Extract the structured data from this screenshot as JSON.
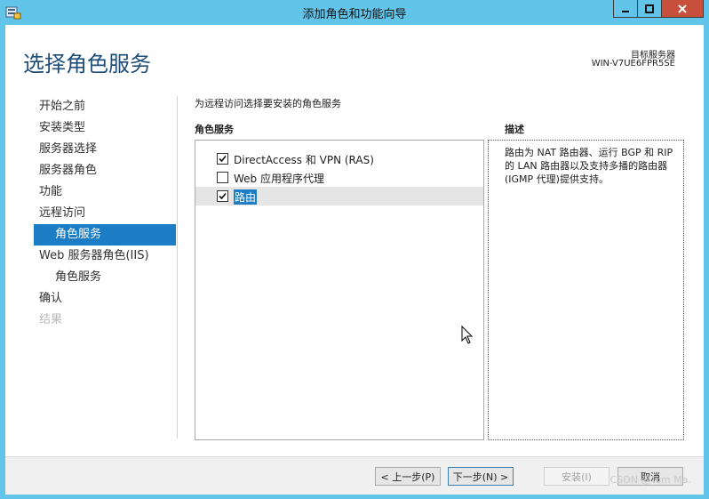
{
  "window": {
    "title": "添加角色和功能向导"
  },
  "header": {
    "page_title": "选择角色服务",
    "target_label": "目标服务器",
    "target_value": "WIN-V7UE6FPR5SE"
  },
  "nav": {
    "items": [
      {
        "label": "开始之前"
      },
      {
        "label": "安装类型"
      },
      {
        "label": "服务器选择"
      },
      {
        "label": "服务器角色"
      },
      {
        "label": "功能"
      },
      {
        "label": "远程访问"
      },
      {
        "label": "角色服务"
      },
      {
        "label": "Web 服务器角色(IIS)"
      },
      {
        "label": "角色服务"
      },
      {
        "label": "确认"
      },
      {
        "label": "结果"
      }
    ]
  },
  "main": {
    "instruction": "为远程访问选择要安装的角色服务",
    "roles_header": "角色服务",
    "roles": [
      {
        "label": "DirectAccess 和 VPN (RAS)",
        "checked": true
      },
      {
        "label": "Web 应用程序代理",
        "checked": false
      },
      {
        "label": "路由",
        "checked": true
      }
    ],
    "description_header": "描述",
    "description": "路由为 NAT 路由器、运行 BGP 和 RIP 的 LAN 路由器以及支持多播的路由器(IGMP 代理)提供支持。"
  },
  "footer": {
    "prev_label": "< 上一步(P)",
    "next_label": "下一步(N) >",
    "install_label": "安装(I)",
    "cancel_label": "取消"
  },
  "watermark": "CSDN @Tom Ma."
}
